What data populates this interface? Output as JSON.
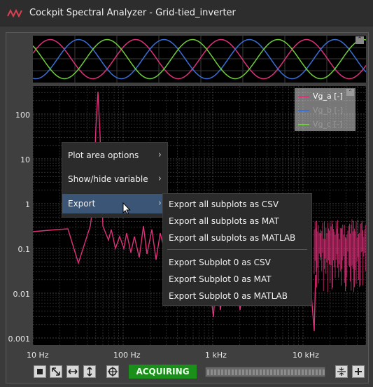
{
  "window": {
    "title": "Cockpit Spectral Analyzer - Grid-tied_inverter"
  },
  "plot": {
    "y_ticks": [
      "100",
      "10",
      "1",
      "0.1",
      "0.01",
      "0.001"
    ],
    "x_ticks": [
      "10 Hz",
      "100 Hz",
      "1 kHz",
      "10 kHz"
    ]
  },
  "legend": {
    "items": [
      {
        "label": "Vg_a  [-]",
        "color": "#e0307a",
        "active": true
      },
      {
        "label": "Vg_b  [-]",
        "color": "#3a6fd8",
        "active": false
      },
      {
        "label": "Vg_c  [-]",
        "color": "#6fcf3a",
        "active": false
      }
    ]
  },
  "context_menu": {
    "items": [
      {
        "label": "Plot area options"
      },
      {
        "label": "Show/hide variable"
      },
      {
        "label": "Export"
      }
    ],
    "highlighted": "Export"
  },
  "export_submenu": {
    "items": [
      "Export all subplots as CSV",
      "Export all subplots as MAT",
      "Export all subplots as MATLAB",
      "Export Subplot 0 as CSV",
      "Export Subplot 0 as MAT",
      "Export Subplot 0 as MATLAB"
    ]
  },
  "status": {
    "label": "ACQUIRING",
    "color": "#1a8f1a"
  },
  "toolbar": {
    "buttons": [
      "stop-icon",
      "zoom-fit-icon",
      "horizontal-expand-icon",
      "vertical-expand-icon",
      "crosshair-icon",
      "collapse-icon",
      "add-icon"
    ]
  }
}
